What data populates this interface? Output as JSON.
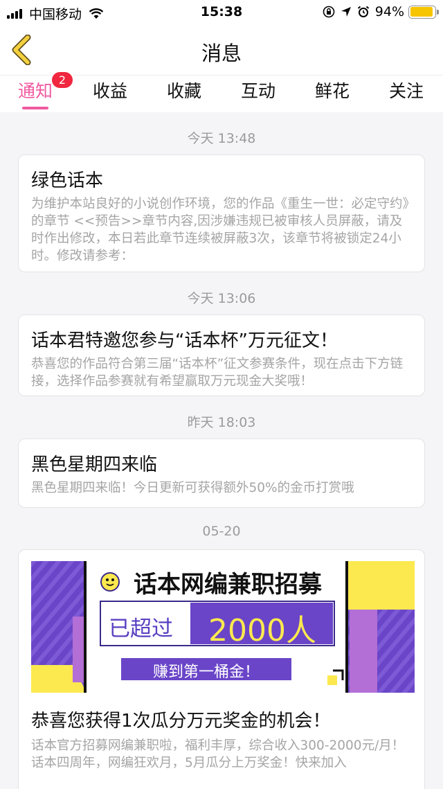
{
  "status_bar": {
    "carrier": "中国移动",
    "time": "15:38",
    "battery": "94%",
    "battery_level": 0.94
  },
  "nav": {
    "title": "消息"
  },
  "tabs": [
    {
      "label": "通知",
      "badge": "2",
      "active": true
    },
    {
      "label": "收益"
    },
    {
      "label": "收藏"
    },
    {
      "label": "互动"
    },
    {
      "label": "鲜花"
    },
    {
      "label": "关注"
    }
  ],
  "messages": [
    {
      "time": "今天 13:48",
      "title": "绿色话本",
      "body": "为维护本站良好的小说创作环境，您的作品《重生一世：必定守约》的章节 <<预告>>章节内容,因涉嫌违规已被审核人员屏蔽，请及时作出修改，本日若此章节连续被屏蔽3次，该章节将被锁定24小时。修改请参考："
    },
    {
      "time": "今天 13:06",
      "title": "话本君特邀您参与“话本杯”万元征文！",
      "body": "恭喜您的作品符合第三届“话本杯”征文参赛条件，现在点击下方链接，选择作品参赛就有希望赢取万元现金大奖哦！"
    },
    {
      "time": "昨天 18:03",
      "title": "黑色星期四来临",
      "body": "黑色星期四来临！今日更新可获得额外50%的金币打赏哦"
    },
    {
      "time": "05-20",
      "banner": {
        "headline": "话本网编兼职招募",
        "over_label": "已超过",
        "count": "2000人",
        "slogan": "赚到第一桶金！"
      },
      "title": "恭喜您获得1次瓜分万元奖金的机会！",
      "body": "话本官方招募网编兼职啦，福利丰厚，综合收入300-2000元/月！\n话本四周年，网编狂欢月，5月瓜分上万奖金！快来加入"
    }
  ],
  "colors": {
    "accent": "#f05aa0",
    "badge": "#f0273f",
    "back_arrow": "#f4d03f",
    "banner_purple": "#6a45c8",
    "banner_yellow": "#fce94f"
  },
  "icons": {
    "back": "chevron-left-icon",
    "wifi": "wifi-icon",
    "location": "location-arrow-icon",
    "alarm": "alarm-clock-icon",
    "lock": "orientation-lock-icon"
  }
}
